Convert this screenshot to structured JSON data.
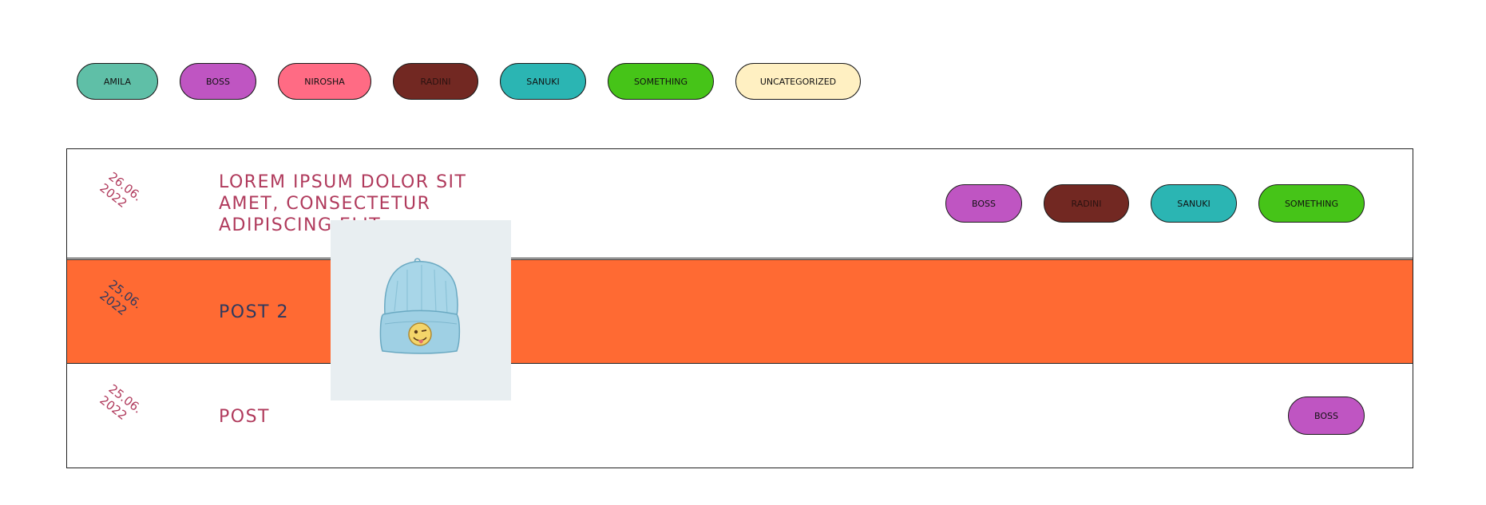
{
  "filters": [
    {
      "label": "AMILA",
      "color": "#5fbfa7",
      "text_color": "#111111"
    },
    {
      "label": "BOSS",
      "color": "#bf55c2",
      "text_color": "#111111"
    },
    {
      "label": "NIROSHA",
      "color": "#ff6b84",
      "text_color": "#111111"
    },
    {
      "label": "RADINI",
      "color": "#722822",
      "text_color": "#2a1210"
    },
    {
      "label": "SANUKI",
      "color": "#2bb5b3",
      "text_color": "#111111"
    },
    {
      "label": "SOMETHING",
      "color": "#46c418",
      "text_color": "#111111"
    },
    {
      "label": "UNCATEGORIZED",
      "color": "#fff0c2",
      "text_color": "#111111"
    }
  ],
  "posts": [
    {
      "date": "26.06.\n2022",
      "title": "LOREM IPSUM DOLOR SIT\nAMET, CONSECTETUR\nADIPISCING ELIT",
      "tags": [
        "BOSS",
        "RADINI",
        "SANUKI",
        "SOMETHING"
      ]
    },
    {
      "date": "25.06.\n2022",
      "title": "POST 2",
      "tags": [],
      "highlight_color": "#ff6a33"
    },
    {
      "date": "25.06.\n2022",
      "title": "POST",
      "tags": [
        "BOSS"
      ]
    }
  ],
  "tag_colors": {
    "BOSS": "#bf55c2",
    "RADINI": "#722822",
    "SANUKI": "#2bb5b3",
    "SOMETHING": "#46c418"
  },
  "hover_image": {
    "icon": "beanie-hat-image"
  }
}
